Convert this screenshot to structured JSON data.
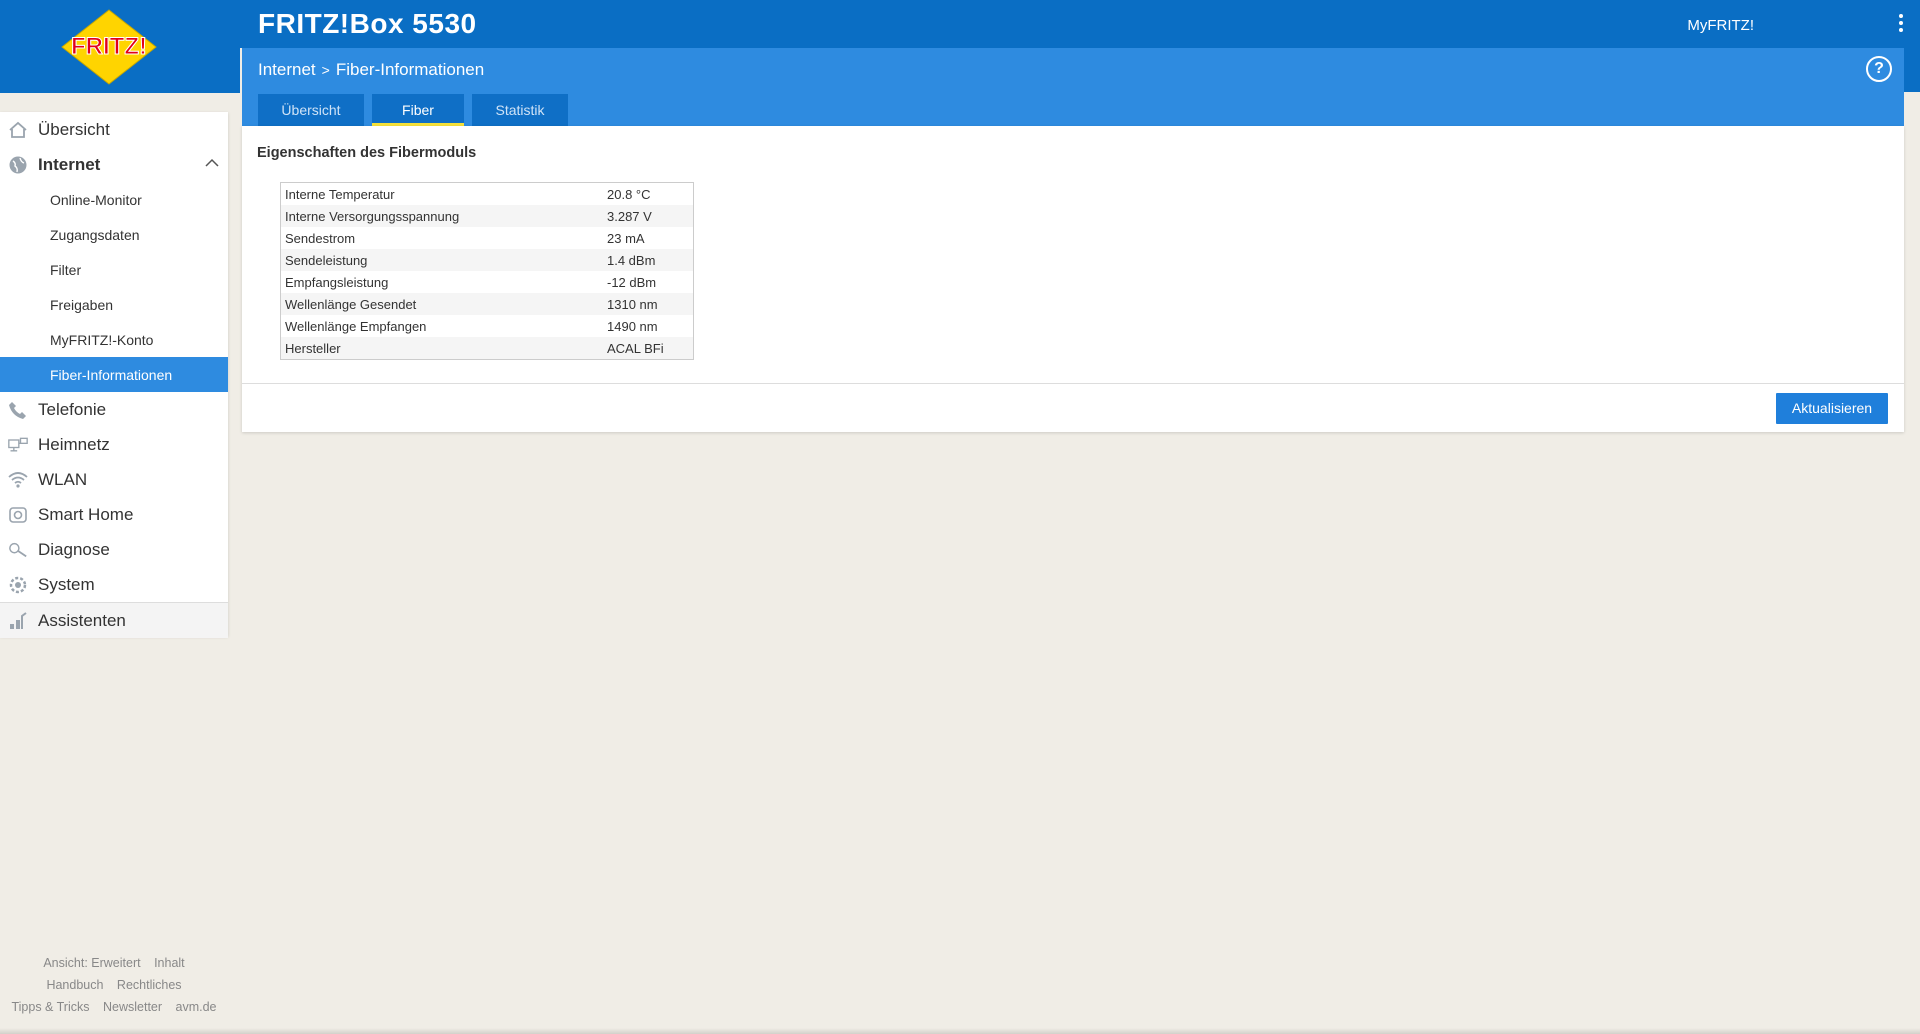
{
  "header": {
    "title": "FRITZ!Box 5530",
    "myfritz": "MyFRITZ!",
    "logo_text": "FRITZ!",
    "help": "?"
  },
  "breadcrumb": {
    "items": [
      "Internet",
      "Fiber-Informationen"
    ],
    "separator": ">"
  },
  "tabs": [
    {
      "label": "Übersicht",
      "active": false
    },
    {
      "label": "Fiber",
      "active": true
    },
    {
      "label": "Statistik",
      "active": false
    }
  ],
  "sidebar": {
    "items": [
      {
        "label": "Übersicht",
        "icon": "home-icon"
      },
      {
        "label": "Internet",
        "icon": "globe-icon",
        "expanded": true
      },
      {
        "label": "Telefonie",
        "icon": "phone-icon"
      },
      {
        "label": "Heimnetz",
        "icon": "network-icon"
      },
      {
        "label": "WLAN",
        "icon": "wifi-icon"
      },
      {
        "label": "Smart Home",
        "icon": "smart-home-icon"
      },
      {
        "label": "Diagnose",
        "icon": "diagnose-icon"
      },
      {
        "label": "System",
        "icon": "system-gear-icon"
      },
      {
        "label": "Assistenten",
        "icon": "assistants-icon"
      }
    ],
    "internet_sub": [
      {
        "label": "Online-Monitor"
      },
      {
        "label": "Zugangsdaten"
      },
      {
        "label": "Filter"
      },
      {
        "label": "Freigaben"
      },
      {
        "label": "MyFRITZ!-Konto"
      },
      {
        "label": "Fiber-Informationen",
        "active": true
      }
    ]
  },
  "footer": {
    "row1": [
      "Ansicht: Erweitert",
      "Inhalt"
    ],
    "row2": [
      "Handbuch",
      "Rechtliches"
    ],
    "row3": [
      "Tipps & Tricks",
      "Newsletter",
      "avm.de"
    ]
  },
  "main": {
    "section_title": "Eigenschaften des Fibermoduls",
    "properties": [
      {
        "label": "Interne Temperatur",
        "value": "20.8 °C"
      },
      {
        "label": "Interne Versorgungsspannung",
        "value": "3.287 V"
      },
      {
        "label": "Sendestrom",
        "value": "23 mA"
      },
      {
        "label": "Sendeleistung",
        "value": "1.4 dBm"
      },
      {
        "label": "Empfangsleistung",
        "value": "-12 dBm"
      },
      {
        "label": "Wellenlänge Gesendet",
        "value": "1310 nm"
      },
      {
        "label": "Wellenlänge Empfangen",
        "value": "1490 nm"
      },
      {
        "label": "Hersteller",
        "value": "ACAL BFi"
      }
    ],
    "refresh_button": "Aktualisieren"
  },
  "colors": {
    "header_blue": "#0a6ec4",
    "bar_blue": "#2e8be0",
    "tab_active_underline": "#f5e13a",
    "background": "#f0ede6",
    "logo_red": "#e2001a",
    "logo_yellow": "#ffd400"
  }
}
